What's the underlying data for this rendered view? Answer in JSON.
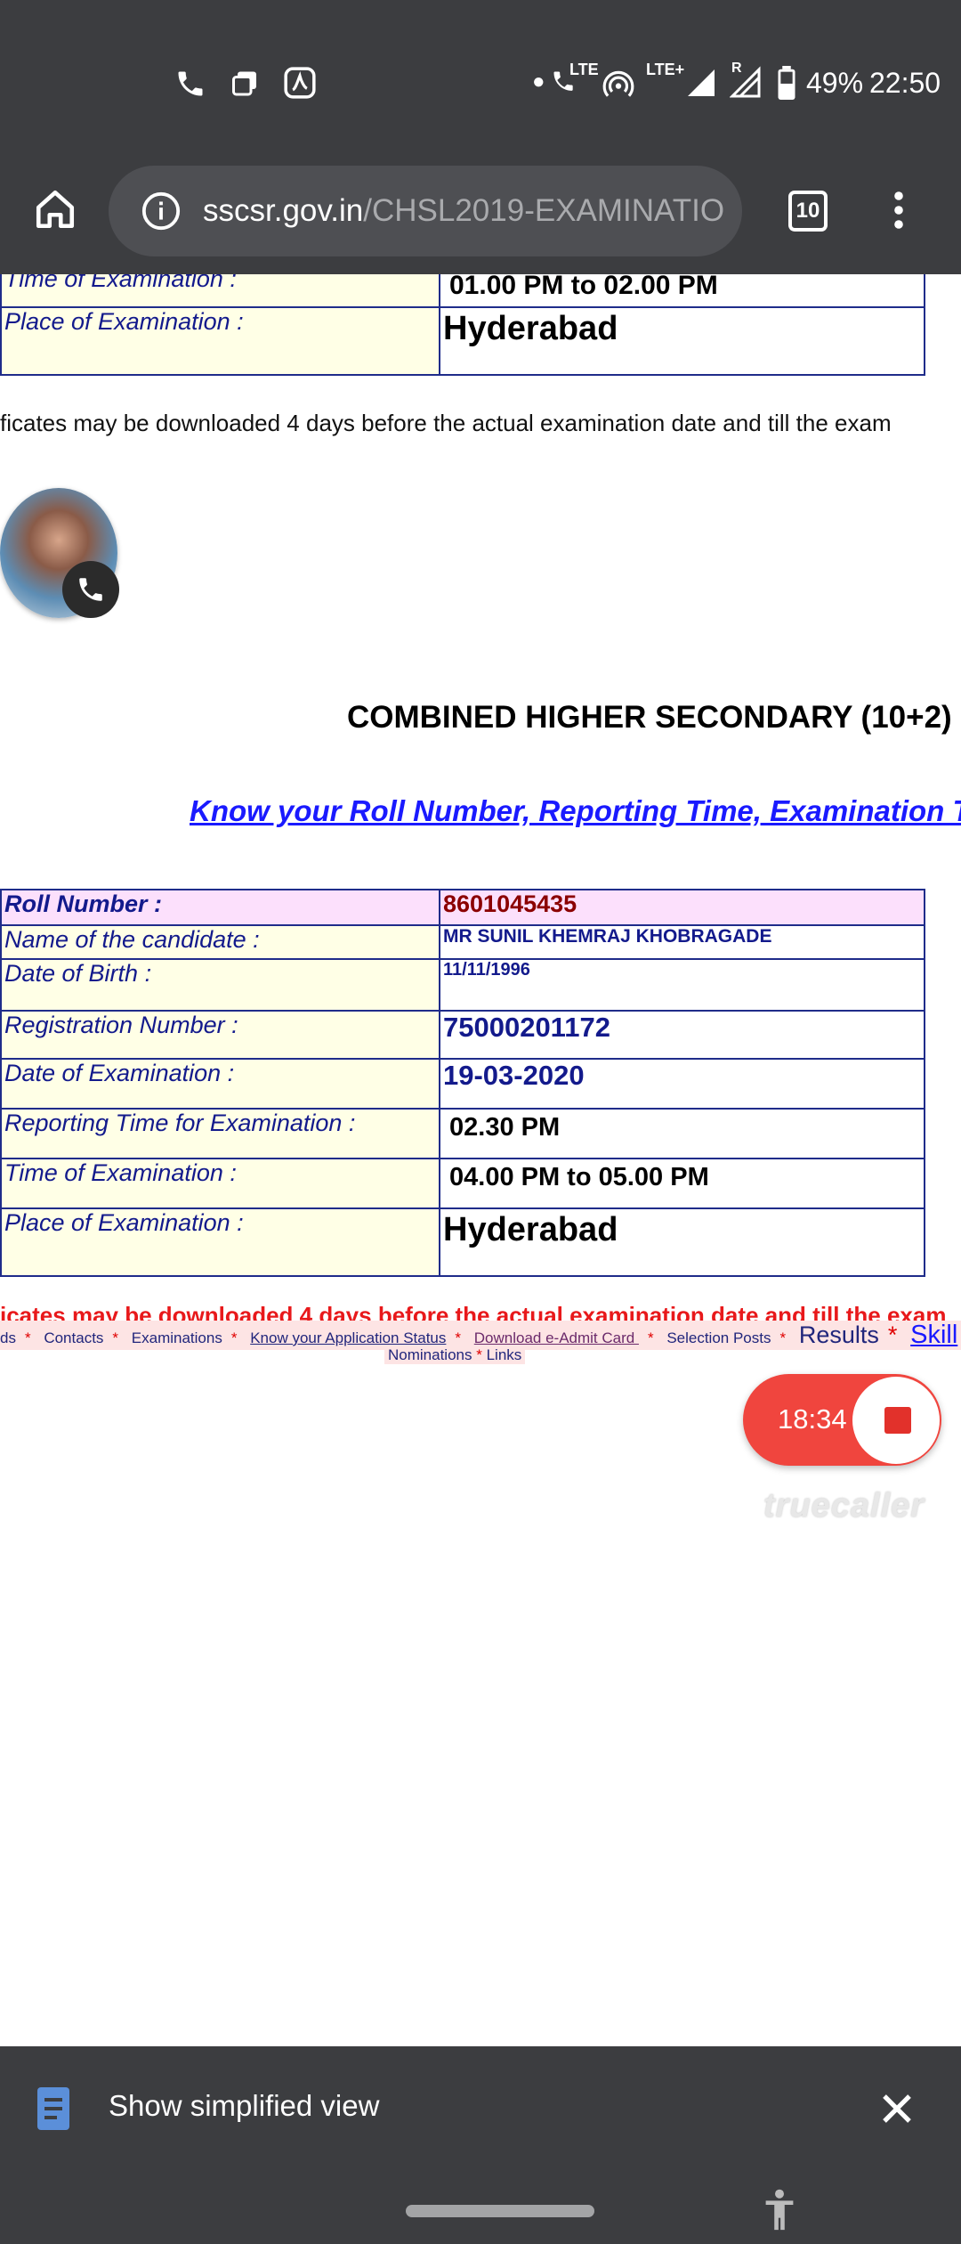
{
  "status_bar": {
    "battery": "49%",
    "time": "22:50",
    "lte": "LTE",
    "lte_plus": "LTE+",
    "roaming": "R"
  },
  "browser": {
    "url_host": "sscsr.gov.in",
    "url_path": "/CHSL2019-EXAMINATIO",
    "tab_count": "10"
  },
  "table_top": {
    "rows": [
      {
        "label": "Time of Examination  :",
        "value": "01.00 PM to 02.00 PM"
      },
      {
        "label": "Place of Examination             :",
        "value": "Hyderabad"
      }
    ]
  },
  "note_top": "ficates may be downloaded 4 days before the actual examination date and till the exam",
  "heading": "COMBINED HIGHER SECONDARY (10+2)",
  "link_heading": "Know your Roll Number, Reporting Time, Examination Ti",
  "table_main": {
    "roll_label": "Roll Number                        :",
    "roll_value": "8601045435",
    "name_label": "Name of the candidate           :",
    "name_value": "MR SUNIL KHEMRAJ KHOBRAGADE",
    "dob_label": "Date of Birth                          :",
    "dob_value": "11/11/1996",
    "reg_label": "Registration Number            :",
    "reg_value": "75000201172",
    "date_label": "Date of Examination  :",
    "date_value": "19-03-2020",
    "report_label": "Reporting Time for Examination  :",
    "report_value": "02.30 PM",
    "time_label": "Time of Examination  :",
    "time_value": "04.00 PM to 05.00 PM",
    "place_label": "Place of Examination             :",
    "place_value": "Hyderabad"
  },
  "note_main": "icates may be downloaded 4 days before the actual examination date and till the exam",
  "recording": {
    "time": "18:34"
  },
  "truecaller": "truecaller",
  "footer": {
    "items": [
      "ds",
      "Contacts",
      "Examinations",
      "Know your Application Status",
      "Download e-Admit Card ",
      "Selection Posts"
    ],
    "results": "Results",
    "skill": "Skill",
    "line2": [
      "Nominations",
      "Links"
    ]
  },
  "simplified_view": {
    "label": "Show simplified view"
  },
  "colors": {
    "bar": "#3c3d40",
    "label_bg": "#ffffe6",
    "roll_bg": "#fce0fc",
    "link": "#1a1aff",
    "note_red": "#e8191b"
  }
}
